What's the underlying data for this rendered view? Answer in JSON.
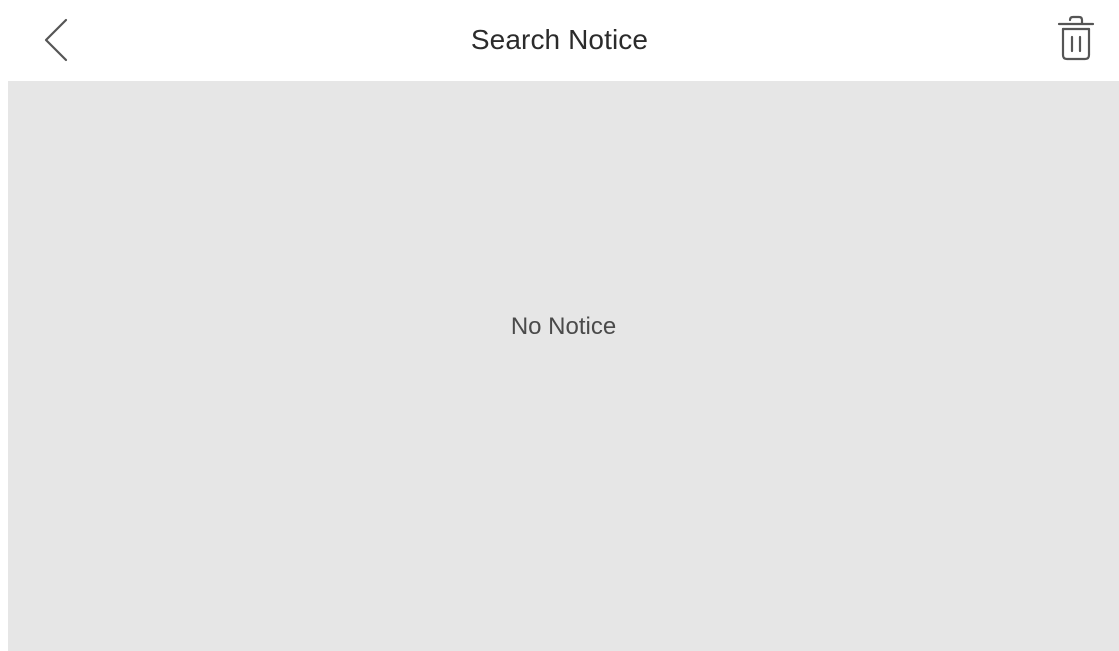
{
  "header": {
    "title": "Search Notice",
    "back_icon": "chevron-left-icon",
    "delete_icon": "trash-icon"
  },
  "main": {
    "empty_message": "No Notice"
  },
  "colors": {
    "header_background": "#ffffff",
    "content_background": "#e6e6e6",
    "title_text": "#2b2b2b",
    "message_text": "#4a4a4a",
    "icon_stroke": "#555555"
  }
}
